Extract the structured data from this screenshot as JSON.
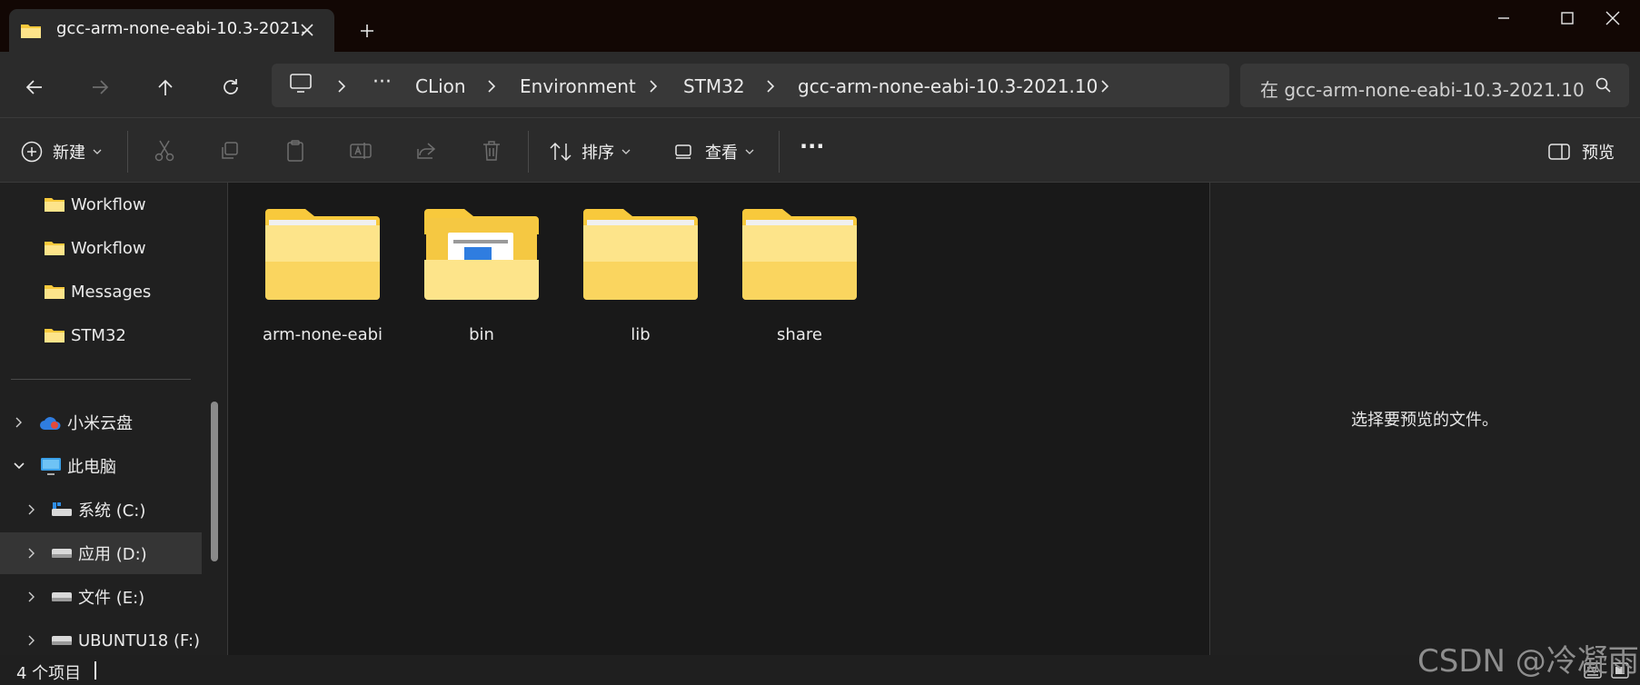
{
  "tab": {
    "title": "gcc-arm-none-eabi-10.3-2021.",
    "icon": "folder-icon"
  },
  "breadcrumbs": [
    "CLion",
    "Environment",
    "STM32",
    "gcc-arm-none-eabi-10.3-2021.10"
  ],
  "breadcrumb_overflow": "···",
  "search": {
    "placeholder": "在 gcc-arm-none-eabi-10.3-2021.10"
  },
  "command_bar": {
    "new_label": "新建",
    "sort_label": "排序",
    "view_label": "查看",
    "more_label": "···",
    "preview_label": "预览"
  },
  "sidebar": {
    "quick_items": [
      "Workflow",
      "Workflow",
      "Messages",
      "STM32"
    ],
    "cloud": "小米云盘",
    "this_pc": "此电脑",
    "drives": [
      "系统 (C:)",
      "应用 (D:)",
      "文件 (E:)",
      "UBUNTU18 (F:)"
    ],
    "selected_drive": "应用 (D:)"
  },
  "folders": [
    "arm-none-eabi",
    "bin",
    "lib",
    "share"
  ],
  "preview": {
    "message": "选择要预览的文件。"
  },
  "status": {
    "item_count": "4 个项目"
  },
  "watermark": "CSDN @冷凝雨",
  "colors": {
    "folder_yellow": "#f8c93c",
    "folder_light": "#fde48a",
    "titlebar": "#120704",
    "pane": "#2b2b2b"
  }
}
